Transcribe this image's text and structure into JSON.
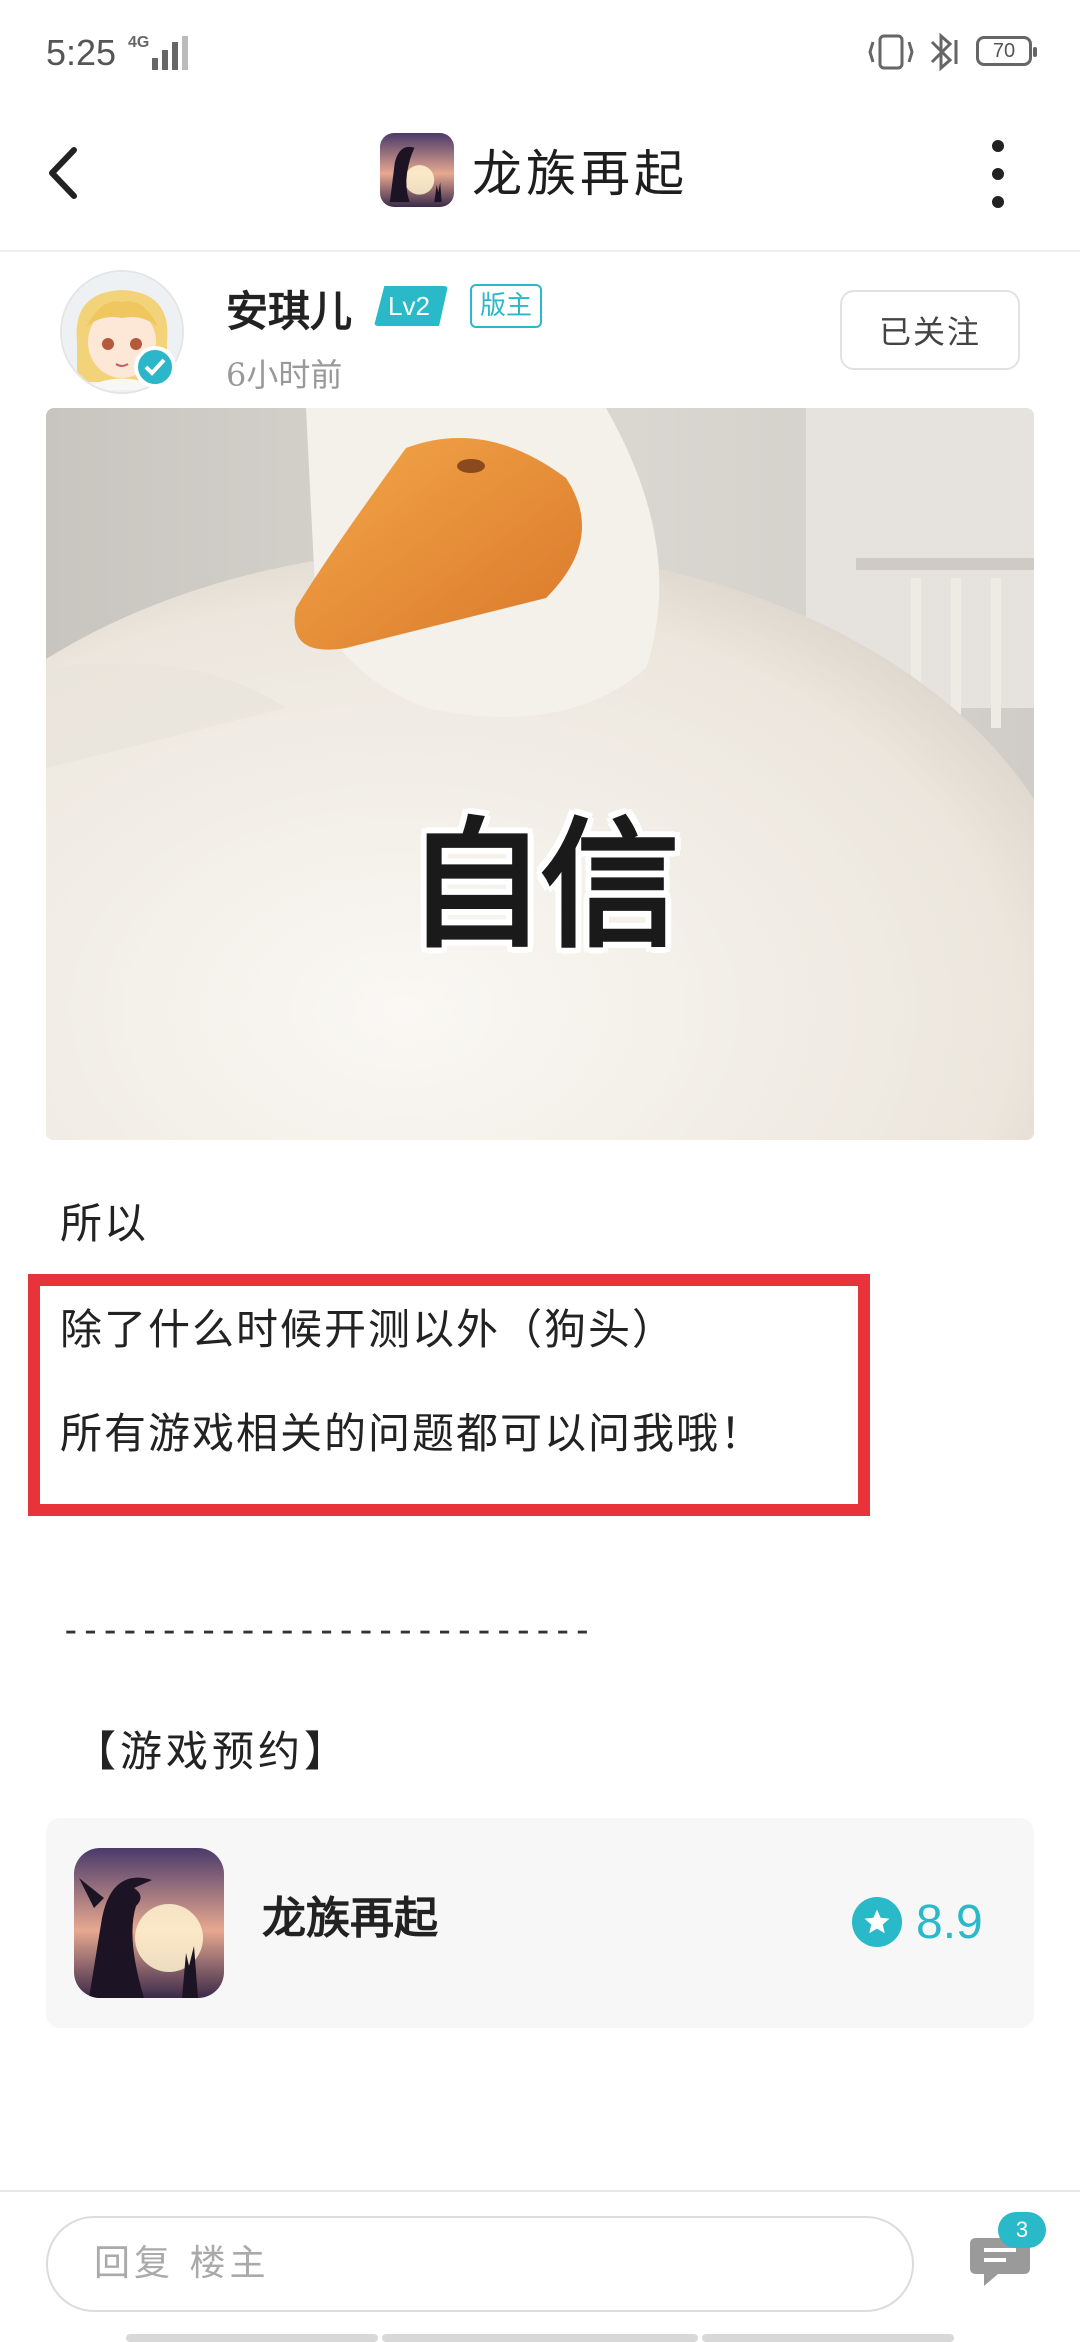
{
  "status_bar": {
    "time": "5:25",
    "network": "4G",
    "battery": "70"
  },
  "header": {
    "title": "龙族再起"
  },
  "author": {
    "name": "安琪儿",
    "level": "Lv2",
    "role_badge": "版主",
    "time": "6小时前",
    "follow_label": "已关注"
  },
  "post": {
    "image_caption": "自信",
    "lines": [
      "所以",
      "除了什么时候开测以外（狗头）",
      "所有游戏相关的问题都可以问我哦！",
      "---------------------------",
      "【游戏预约】"
    ]
  },
  "game_card": {
    "name": "龙族再起",
    "rating": "8.9"
  },
  "bottom_bar": {
    "reply_placeholder": "回复  楼主",
    "comment_count": "3"
  },
  "colors": {
    "accent": "#29b9c8",
    "highlight_box": "#e8333a"
  }
}
